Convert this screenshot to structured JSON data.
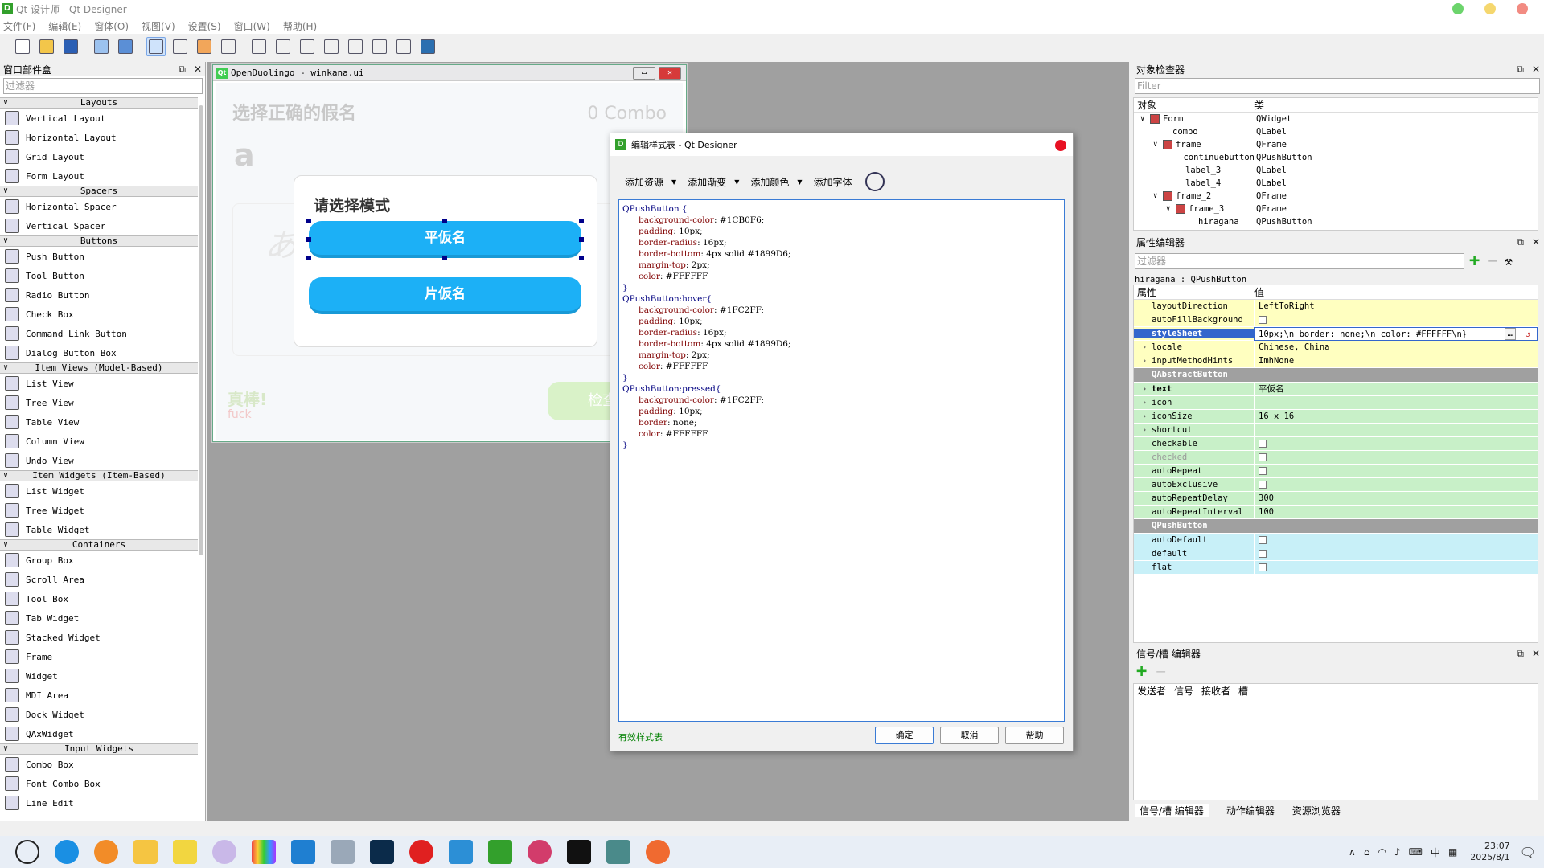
{
  "title": "Qt 设计师 - Qt Designer",
  "menu": [
    "文件(F)",
    "编辑(E)",
    "窗体(O)",
    "视图(V)",
    "设置(S)",
    "窗口(W)",
    "帮助(H)"
  ],
  "widgetbox": {
    "title": "窗口部件盒",
    "filter_placeholder": "过滤器",
    "categories": [
      {
        "name": "Layouts",
        "items": [
          "Vertical Layout",
          "Horizontal Layout",
          "Grid Layout",
          "Form Layout"
        ]
      },
      {
        "name": "Spacers",
        "items": [
          "Horizontal Spacer",
          "Vertical Spacer"
        ]
      },
      {
        "name": "Buttons",
        "items": [
          "Push Button",
          "Tool Button",
          "Radio Button",
          "Check Box",
          "Command Link Button",
          "Dialog Button Box"
        ]
      },
      {
        "name": "Item Views (Model-Based)",
        "items": [
          "List View",
          "Tree View",
          "Table View",
          "Column View",
          "Undo View"
        ]
      },
      {
        "name": "Item Widgets (Item-Based)",
        "items": [
          "List Widget",
          "Tree Widget",
          "Table Widget"
        ]
      },
      {
        "name": "Containers",
        "items": [
          "Group Box",
          "Scroll Area",
          "Tool Box",
          "Tab Widget",
          "Stacked Widget",
          "Frame",
          "Widget",
          "MDI Area",
          "Dock Widget",
          "QAxWidget"
        ]
      },
      {
        "name": "Input Widgets",
        "items": [
          "Combo Box",
          "Font Combo Box",
          "Line Edit"
        ]
      }
    ]
  },
  "form": {
    "window_title": "OpenDuolingo - winkana.ui",
    "qt_badge": "Qt",
    "heading": "选择正确的假名",
    "combo": "0 Combo",
    "char": "a",
    "kana_ghost": "あ",
    "mode_title": "请选择模式",
    "btn_hiragana": "平仮名",
    "btn_katakana": "片仮名",
    "great": "真棒!",
    "fuck": "fuck",
    "check": "检查"
  },
  "stylesheet_dialog": {
    "title": "编辑样式表 - Qt Designer",
    "tools": [
      "添加资源",
      "添加渐变",
      "添加颜色",
      "添加字体"
    ],
    "valid": "有效样式表",
    "ok": "确定",
    "cancel": "取消",
    "help": "帮助",
    "code": [
      {
        "sel": "QPushButton {"
      },
      {
        "p": "background-color",
        "v": "#1CB0F6;"
      },
      {
        "p": "padding",
        "v": "10px;"
      },
      {
        "p": "border-radius",
        "v": "16px;"
      },
      {
        "p": "border-bottom",
        "v": "4px solid #1899D6;"
      },
      {
        "p": "margin-top",
        "v": "2px;"
      },
      {
        "p": "color",
        "v": "#FFFFFF"
      },
      {
        "sel": "}"
      },
      {
        "sel": "QPushButton:hover{"
      },
      {
        "p": "background-color",
        "v": "#1FC2FF;"
      },
      {
        "p": "padding",
        "v": "10px;"
      },
      {
        "p": "border-radius",
        "v": "16px;"
      },
      {
        "p": "border-bottom",
        "v": "4px solid #1899D6;"
      },
      {
        "p": "margin-top",
        "v": "2px;"
      },
      {
        "p": "color",
        "v": "#FFFFFF"
      },
      {
        "sel": "}"
      },
      {
        "sel": "QPushButton:pressed{"
      },
      {
        "p": "background-color",
        "v": "#1FC2FF;"
      },
      {
        "p": "padding",
        "v": "10px;"
      },
      {
        "p": "border",
        "v": "none;"
      },
      {
        "p": "color",
        "v": "#FFFFFF"
      },
      {
        "sel": "}"
      }
    ]
  },
  "object_inspector": {
    "title": "对象检查器",
    "filter_placeholder": "Filter",
    "col_object": "对象",
    "col_class": "类",
    "rows": [
      {
        "name": "Form",
        "cls": "QWidget",
        "indent": 1,
        "icon": true,
        "exp": true
      },
      {
        "name": "combo",
        "cls": "QLabel",
        "indent": 2,
        "icon": false,
        "exp": false
      },
      {
        "name": "frame",
        "cls": "QFrame",
        "indent": 2,
        "icon": true,
        "exp": true
      },
      {
        "name": "continuebutton",
        "cls": "QPushButton",
        "indent": 3,
        "icon": false,
        "exp": false
      },
      {
        "name": "label_3",
        "cls": "QLabel",
        "indent": 3,
        "icon": false,
        "exp": false
      },
      {
        "name": "label_4",
        "cls": "QLabel",
        "indent": 3,
        "icon": false,
        "exp": false
      },
      {
        "name": "frame_2",
        "cls": "QFrame",
        "indent": 2,
        "icon": true,
        "exp": true
      },
      {
        "name": "frame_3",
        "cls": "QFrame",
        "indent": 3,
        "icon": true,
        "exp": true
      },
      {
        "name": "hiragana",
        "cls": "QPushButton",
        "indent": 4,
        "icon": false,
        "exp": false
      }
    ]
  },
  "property_editor": {
    "title": "属性编辑器",
    "filter_placeholder": "过滤器",
    "context": "hiragana : QPushButton",
    "col_prop": "属性",
    "col_val": "值",
    "rows": [
      {
        "k": "layoutDirection",
        "v": "LeftToRight",
        "c": "yellow"
      },
      {
        "k": "autoFillBackground",
        "v": "",
        "cb": true,
        "c": "yellow"
      },
      {
        "k": "styleSheet",
        "v": "10px;\\n    border: none;\\n       color: #FFFFFF\\n}",
        "c": "yellow",
        "hl": true
      },
      {
        "k": "locale",
        "v": "Chinese, China",
        "c": "yellow",
        "exp": true
      },
      {
        "k": "inputMethodHints",
        "v": "ImhNone",
        "c": "yellow",
        "exp": true
      },
      {
        "group": "QAbstractButton"
      },
      {
        "k": "text",
        "v": "平仮名",
        "c": "green",
        "exp": true,
        "bold": true
      },
      {
        "k": "icon",
        "v": "",
        "c": "green",
        "exp": true
      },
      {
        "k": "iconSize",
        "v": "16 x 16",
        "c": "green",
        "exp": true
      },
      {
        "k": "shortcut",
        "v": "",
        "c": "green",
        "exp": true
      },
      {
        "k": "checkable",
        "v": "",
        "cb": true,
        "c": "green"
      },
      {
        "k": "checked",
        "v": "",
        "cb": true,
        "c": "green",
        "dim": true
      },
      {
        "k": "autoRepeat",
        "v": "",
        "cb": true,
        "c": "green"
      },
      {
        "k": "autoExclusive",
        "v": "",
        "cb": true,
        "c": "green"
      },
      {
        "k": "autoRepeatDelay",
        "v": "300",
        "c": "green"
      },
      {
        "k": "autoRepeatInterval",
        "v": "100",
        "c": "green"
      },
      {
        "group": "QPushButton"
      },
      {
        "k": "autoDefault",
        "v": "",
        "cb": true,
        "c": "cyan"
      },
      {
        "k": "default",
        "v": "",
        "cb": true,
        "c": "cyan"
      },
      {
        "k": "flat",
        "v": "",
        "cb": true,
        "c": "cyan"
      }
    ]
  },
  "signal_editor": {
    "title": "信号/槽 编辑器",
    "cols": [
      "发送者",
      "信号",
      "接收者",
      "槽"
    ]
  },
  "bottom_tabs": [
    "信号/槽 编辑器",
    "动作编辑器",
    "资源浏览器"
  ],
  "tray": {
    "time": "23:07",
    "date": "2025/8/1",
    "ime": "中"
  }
}
